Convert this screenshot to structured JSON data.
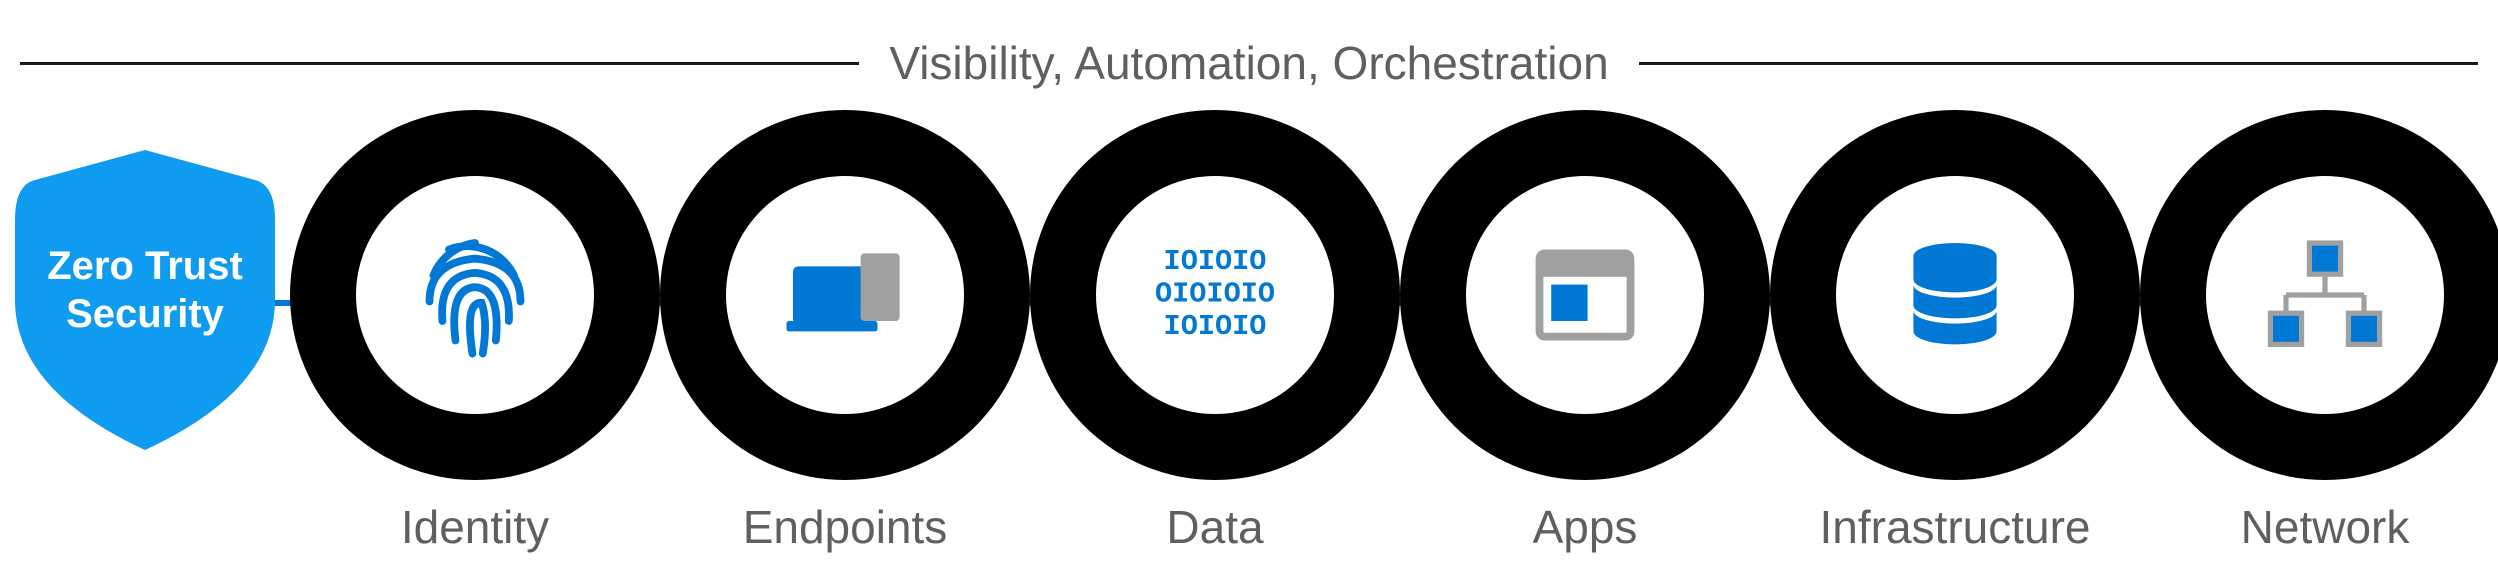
{
  "header": {
    "title": "Visibility, Automation, Orchestration"
  },
  "shield": {
    "label": "Zero Trust\nSecurity"
  },
  "pillars": [
    {
      "label": "Identity",
      "icon": "fingerprint-icon"
    },
    {
      "label": "Endpoints",
      "icon": "devices-icon"
    },
    {
      "label": "Data",
      "icon": "binary-data-icon"
    },
    {
      "label": "Apps",
      "icon": "app-window-icon"
    },
    {
      "label": "Infrastructure",
      "icon": "database-icon"
    },
    {
      "label": "Network",
      "icon": "network-icon"
    }
  ],
  "colors": {
    "accent": "#0078d4",
    "ring": "#000000",
    "text": "#5f5f5f",
    "secondary": "#a0a0a0"
  }
}
